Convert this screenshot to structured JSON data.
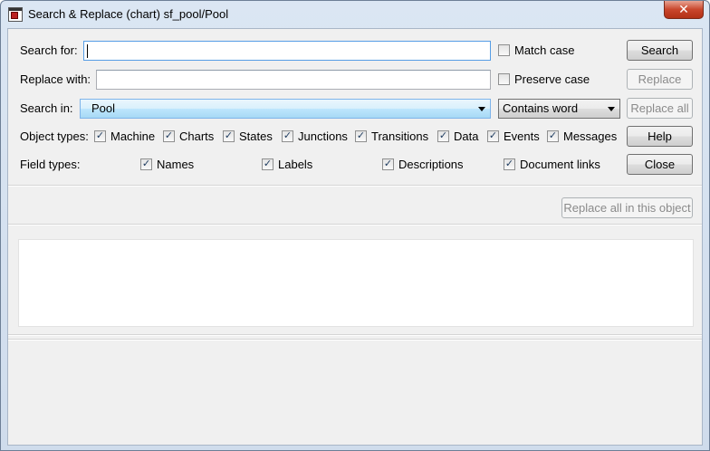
{
  "window": {
    "title": "Search & Replace (chart) sf_pool/Pool",
    "close_glyph": "✕"
  },
  "search": {
    "label": "Search for:",
    "value": ""
  },
  "replace": {
    "label": "Replace with:",
    "value": ""
  },
  "options": {
    "match_case": {
      "label": "Match case",
      "checked": false
    },
    "preserve_case": {
      "label": "Preserve case",
      "checked": false
    }
  },
  "search_in": {
    "label": "Search in:",
    "value": "Pool"
  },
  "match_mode": {
    "value": "Contains word"
  },
  "object_types": {
    "label": "Object types:",
    "items": [
      {
        "label": "Machine",
        "checked": true
      },
      {
        "label": "Charts",
        "checked": true
      },
      {
        "label": "States",
        "checked": true
      },
      {
        "label": "Junctions",
        "checked": true
      },
      {
        "label": "Transitions",
        "checked": true
      },
      {
        "label": "Data",
        "checked": true
      },
      {
        "label": "Events",
        "checked": true
      },
      {
        "label": "Messages",
        "checked": true
      }
    ]
  },
  "field_types": {
    "label": "Field types:",
    "items": [
      {
        "label": "Names",
        "checked": true
      },
      {
        "label": "Labels",
        "checked": true
      },
      {
        "label": "Descriptions",
        "checked": true
      },
      {
        "label": "Document links",
        "checked": true
      }
    ]
  },
  "buttons": {
    "search": "Search",
    "replace": "Replace",
    "replace_all": "Replace all",
    "help": "Help",
    "close": "Close",
    "replace_all_in_object": "Replace all in this object"
  }
}
